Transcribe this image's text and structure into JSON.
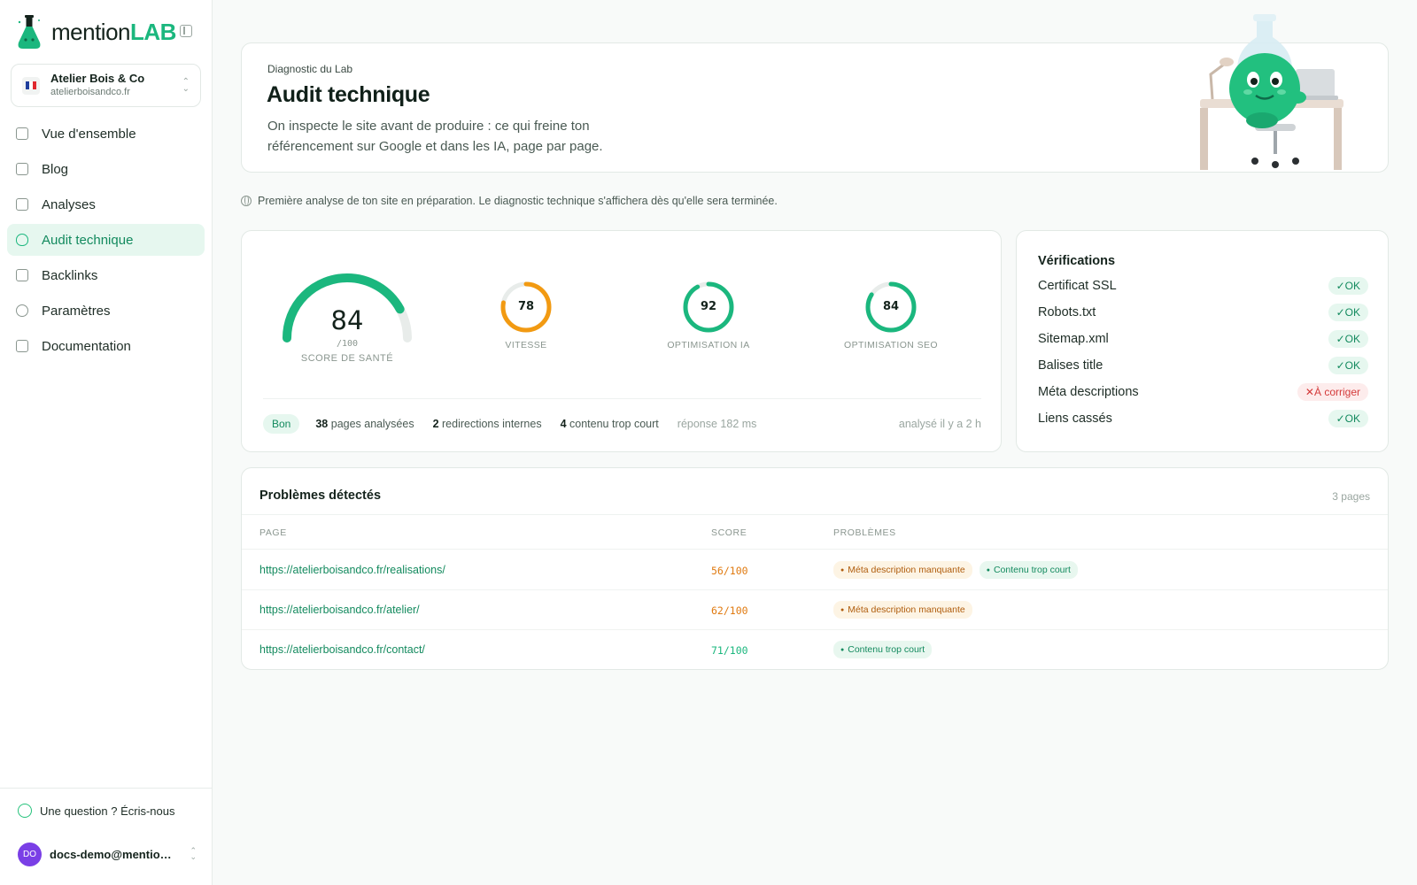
{
  "brand": {
    "name_plain": "mention",
    "name_accent": "LAB"
  },
  "site": {
    "name": "Atelier Bois & Co",
    "domain": "atelierboisandco.fr"
  },
  "nav": [
    {
      "label": "Vue d'ensemble",
      "icon": "grid-icon"
    },
    {
      "label": "Blog",
      "icon": "calendar-icon"
    },
    {
      "label": "Analyses",
      "icon": "bar-chart-icon"
    },
    {
      "label": "Audit technique",
      "icon": "shield-icon",
      "active": true
    },
    {
      "label": "Backlinks",
      "icon": "external-link-icon"
    },
    {
      "label": "Paramètres",
      "icon": "gear-icon"
    },
    {
      "label": "Documentation",
      "icon": "book-icon"
    }
  ],
  "help": {
    "label": "Une question ? Écris-nous",
    "icon": "whatsapp-icon"
  },
  "user": {
    "initials": "DO",
    "email": "docs-demo@mentionl..."
  },
  "hero": {
    "eyebrow": "Diagnostic du Lab",
    "title": "Audit technique",
    "description": "On inspecte le site avant de produire : ce qui freine ton référencement sur Google et dans les IA, page par page."
  },
  "notice": "Première analyse de ton site en préparation. Le diagnostic technique s'affichera dès qu'elle sera terminée.",
  "health": {
    "value": "84",
    "max": "/100",
    "label": "SCORE DE SANTÉ",
    "fraction": 0.84
  },
  "rings": [
    {
      "value": "78",
      "label": "VITESSE",
      "fraction": 0.78,
      "color": "#f29a12"
    },
    {
      "value": "92",
      "label": "OPTIMISATION IA",
      "fraction": 0.92,
      "color": "#1bb77e"
    },
    {
      "value": "84",
      "label": "OPTIMISATION SEO",
      "fraction": 0.84,
      "color": "#1bb77e"
    }
  ],
  "stats": {
    "status": "Bon",
    "pages_count": "38",
    "pages_label": "pages analysées",
    "redirects_count": "2",
    "redirects_label": "redirections internes",
    "short_count": "4",
    "short_label": "contenu trop court",
    "response": "réponse 182 ms",
    "analyzed": "analysé il y a 2 h"
  },
  "checks": {
    "title": "Vérifications",
    "items": [
      {
        "label": "Certificat SSL",
        "status": "OK"
      },
      {
        "label": "Robots.txt",
        "status": "OK"
      },
      {
        "label": "Sitemap.xml",
        "status": "OK"
      },
      {
        "label": "Balises title",
        "status": "OK"
      },
      {
        "label": "Méta descriptions",
        "status": "À corriger"
      },
      {
        "label": "Liens cassés",
        "status": "OK"
      }
    ]
  },
  "problems": {
    "title": "Problèmes détectés",
    "count": "3 pages",
    "columns": [
      "PAGE",
      "SCORE",
      "PROBLÈMES"
    ],
    "rows": [
      {
        "url": "https://atelierboisandco.fr/realisations/",
        "score": "56/100",
        "score_color": "#e07a10",
        "tags": [
          {
            "label": "Méta description manquante",
            "kind": "warn"
          },
          {
            "label": "Contenu trop court",
            "kind": "info"
          }
        ]
      },
      {
        "url": "https://atelierboisandco.fr/atelier/",
        "score": "62/100",
        "score_color": "#e07a10",
        "tags": [
          {
            "label": "Méta description manquante",
            "kind": "warn"
          }
        ]
      },
      {
        "url": "https://atelierboisandco.fr/contact/",
        "score": "71/100",
        "score_color": "#1bb77e",
        "tags": [
          {
            "label": "Contenu trop court",
            "kind": "info"
          }
        ]
      }
    ]
  },
  "colors": {
    "accent": "#1bb77e",
    "accent_dark": "#138a5e",
    "warning": "#f29a12",
    "danger": "#d43a3a"
  }
}
